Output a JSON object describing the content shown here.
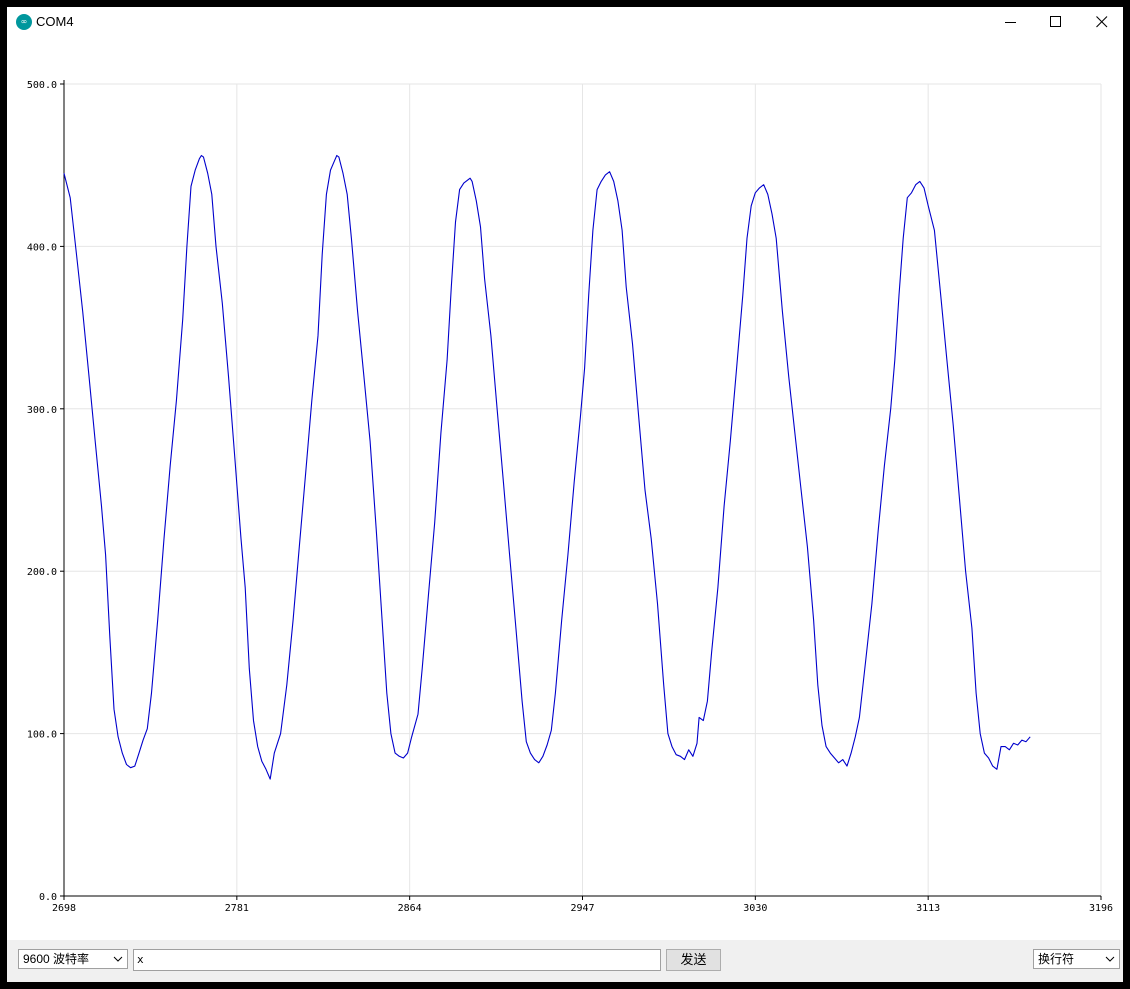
{
  "window": {
    "title": "COM4",
    "app_icon": "arduino-logo-icon"
  },
  "window_controls": {
    "minimize_icon": "minimize-icon",
    "maximize_icon": "maximize-icon",
    "close_icon": "close-icon"
  },
  "chart_data": {
    "type": "line",
    "title": "",
    "xlabel": "",
    "ylabel": "",
    "xlim": [
      2698,
      3196
    ],
    "ylim": [
      0,
      500
    ],
    "grid": true,
    "x_ticks": [
      "2698",
      "2781",
      "2864",
      "2947",
      "3030",
      "3113",
      "3196"
    ],
    "y_ticks": [
      "0.0",
      "100.0",
      "200.0",
      "300.0",
      "400.0",
      "500.0"
    ],
    "series": [
      {
        "color": "#0000cc",
        "points": [
          [
            2698,
            445
          ],
          [
            2701,
            430
          ],
          [
            2704,
            395
          ],
          [
            2707,
            360
          ],
          [
            2710,
            320
          ],
          [
            2713,
            280
          ],
          [
            2716,
            240
          ],
          [
            2718,
            210
          ],
          [
            2720,
            160
          ],
          [
            2722,
            115
          ],
          [
            2724,
            98
          ],
          [
            2726,
            88
          ],
          [
            2728,
            81
          ],
          [
            2730,
            79
          ],
          [
            2732,
            80
          ],
          [
            2734,
            88
          ],
          [
            2736,
            96
          ],
          [
            2738,
            103
          ],
          [
            2740,
            125
          ],
          [
            2743,
            170
          ],
          [
            2746,
            220
          ],
          [
            2749,
            265
          ],
          [
            2752,
            305
          ],
          [
            2755,
            355
          ],
          [
            2757,
            400
          ],
          [
            2759,
            437
          ],
          [
            2761,
            447
          ],
          [
            2763,
            454
          ],
          [
            2764,
            456
          ],
          [
            2765,
            455
          ],
          [
            2767,
            445
          ],
          [
            2769,
            432
          ],
          [
            2771,
            400
          ],
          [
            2774,
            365
          ],
          [
            2777,
            320
          ],
          [
            2780,
            270
          ],
          [
            2783,
            220
          ],
          [
            2785,
            190
          ],
          [
            2787,
            140
          ],
          [
            2789,
            108
          ],
          [
            2791,
            92
          ],
          [
            2793,
            83
          ],
          [
            2795,
            78
          ],
          [
            2797,
            72
          ],
          [
            2799,
            88
          ],
          [
            2802,
            100
          ],
          [
            2805,
            130
          ],
          [
            2808,
            170
          ],
          [
            2811,
            215
          ],
          [
            2814,
            260
          ],
          [
            2817,
            305
          ],
          [
            2820,
            345
          ],
          [
            2822,
            395
          ],
          [
            2824,
            432
          ],
          [
            2826,
            447
          ],
          [
            2828,
            453
          ],
          [
            2829,
            456
          ],
          [
            2830,
            455
          ],
          [
            2832,
            445
          ],
          [
            2834,
            432
          ],
          [
            2836,
            405
          ],
          [
            2839,
            360
          ],
          [
            2842,
            320
          ],
          [
            2845,
            280
          ],
          [
            2848,
            225
          ],
          [
            2851,
            165
          ],
          [
            2853,
            125
          ],
          [
            2855,
            100
          ],
          [
            2857,
            88
          ],
          [
            2859,
            86
          ],
          [
            2861,
            85
          ],
          [
            2863,
            88
          ],
          [
            2865,
            98
          ],
          [
            2868,
            112
          ],
          [
            2870,
            140
          ],
          [
            2873,
            185
          ],
          [
            2876,
            230
          ],
          [
            2879,
            285
          ],
          [
            2882,
            330
          ],
          [
            2884,
            375
          ],
          [
            2886,
            415
          ],
          [
            2888,
            435
          ],
          [
            2890,
            439
          ],
          [
            2892,
            441
          ],
          [
            2893,
            442
          ],
          [
            2894,
            440
          ],
          [
            2896,
            428
          ],
          [
            2898,
            412
          ],
          [
            2900,
            380
          ],
          [
            2903,
            345
          ],
          [
            2906,
            300
          ],
          [
            2909,
            255
          ],
          [
            2912,
            210
          ],
          [
            2915,
            165
          ],
          [
            2918,
            120
          ],
          [
            2920,
            95
          ],
          [
            2922,
            88
          ],
          [
            2924,
            84
          ],
          [
            2926,
            82
          ],
          [
            2928,
            86
          ],
          [
            2930,
            93
          ],
          [
            2932,
            102
          ],
          [
            2934,
            125
          ],
          [
            2937,
            170
          ],
          [
            2940,
            210
          ],
          [
            2943,
            255
          ],
          [
            2946,
            295
          ],
          [
            2948,
            325
          ],
          [
            2950,
            370
          ],
          [
            2952,
            410
          ],
          [
            2954,
            435
          ],
          [
            2956,
            440
          ],
          [
            2958,
            444
          ],
          [
            2960,
            446
          ],
          [
            2962,
            440
          ],
          [
            2964,
            428
          ],
          [
            2966,
            410
          ],
          [
            2968,
            375
          ],
          [
            2971,
            340
          ],
          [
            2974,
            295
          ],
          [
            2977,
            250
          ],
          [
            2980,
            220
          ],
          [
            2983,
            180
          ],
          [
            2986,
            130
          ],
          [
            2988,
            100
          ],
          [
            2990,
            92
          ],
          [
            2992,
            87
          ],
          [
            2994,
            86
          ],
          [
            2996,
            84
          ],
          [
            2998,
            90
          ],
          [
            3000,
            86
          ],
          [
            3002,
            94
          ],
          [
            3003,
            110
          ],
          [
            3005,
            108
          ],
          [
            3007,
            120
          ],
          [
            3009,
            150
          ],
          [
            3012,
            190
          ],
          [
            3015,
            240
          ],
          [
            3018,
            280
          ],
          [
            3021,
            325
          ],
          [
            3024,
            370
          ],
          [
            3026,
            405
          ],
          [
            3028,
            425
          ],
          [
            3030,
            433
          ],
          [
            3032,
            436
          ],
          [
            3034,
            438
          ],
          [
            3036,
            432
          ],
          [
            3038,
            420
          ],
          [
            3040,
            405
          ],
          [
            3043,
            360
          ],
          [
            3046,
            320
          ],
          [
            3049,
            285
          ],
          [
            3052,
            250
          ],
          [
            3055,
            215
          ],
          [
            3058,
            170
          ],
          [
            3060,
            130
          ],
          [
            3062,
            105
          ],
          [
            3064,
            92
          ],
          [
            3066,
            88
          ],
          [
            3068,
            85
          ],
          [
            3070,
            82
          ],
          [
            3072,
            84
          ],
          [
            3074,
            80
          ],
          [
            3076,
            88
          ],
          [
            3078,
            98
          ],
          [
            3080,
            110
          ],
          [
            3083,
            145
          ],
          [
            3086,
            180
          ],
          [
            3089,
            225
          ],
          [
            3092,
            265
          ],
          [
            3095,
            300
          ],
          [
            3097,
            330
          ],
          [
            3099,
            370
          ],
          [
            3101,
            405
          ],
          [
            3103,
            430
          ],
          [
            3105,
            433
          ],
          [
            3107,
            438
          ],
          [
            3109,
            440
          ],
          [
            3111,
            436
          ],
          [
            3113,
            425
          ],
          [
            3116,
            410
          ],
          [
            3119,
            370
          ],
          [
            3122,
            330
          ],
          [
            3125,
            290
          ],
          [
            3128,
            245
          ],
          [
            3131,
            200
          ],
          [
            3134,
            165
          ],
          [
            3136,
            125
          ],
          [
            3138,
            100
          ],
          [
            3140,
            88
          ],
          [
            3142,
            85
          ],
          [
            3144,
            80
          ],
          [
            3146,
            78
          ],
          [
            3148,
            92
          ],
          [
            3150,
            92
          ],
          [
            3152,
            90
          ],
          [
            3154,
            94
          ],
          [
            3156,
            93
          ],
          [
            3158,
            96
          ],
          [
            3160,
            95
          ],
          [
            3162,
            98
          ]
        ]
      }
    ]
  },
  "bottombar": {
    "baud_select": {
      "value": "9600  波特率",
      "icon": "chevron-down-icon"
    },
    "send_input": {
      "value": "x"
    },
    "send_button": {
      "label": "发送"
    },
    "line_ending_select": {
      "value": "换行符",
      "icon": "chevron-down-icon"
    }
  }
}
